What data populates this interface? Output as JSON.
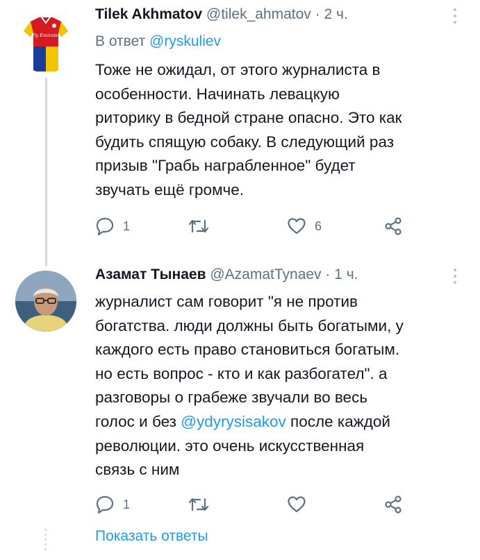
{
  "tweet1": {
    "name": "Tilek Akhmatov",
    "handle": "@tilek_ahmatov",
    "sep": "·",
    "time": "2 ч.",
    "reply_prefix": "В ответ",
    "reply_to": "@ryskuliev",
    "text": "Тоже не ожидал, от этого журналиста в\nособенности. Начинать левацкую\nриторику в  бедной стране опасно. Это как\nбудить спящую собаку. В следующий раз\nпризыв \"Грабь награбленное\" будет\nзвучать ещё громче.",
    "actions": {
      "reply_count": "1",
      "retweet_count": "",
      "like_count": "6"
    },
    "avatar_text": "Fly Emirates"
  },
  "tweet2": {
    "name": "Азамат Тынаев",
    "handle": "@AzamatTynaev",
    "sep": "·",
    "time": "1 ч.",
    "text_before": "журналист сам говорит \"я не против\nбогатства. люди должны быть богатыми, у\nкаждого есть право становиться богатым.\nно есть вопрос - кто и как разбогател\". а\nразговоры о грабеже звучали во весь\nголос и без ",
    "mention": "@ydyrysisakov",
    "text_after": " после каждой\nреволюции. это очень искусственная\nсвязь с ним",
    "actions": {
      "reply_count": "1",
      "retweet_count": "",
      "like_count": ""
    }
  },
  "show_replies": "Показать ответы",
  "colors": {
    "link": "#1d9bf0",
    "secondary": "#5b7083",
    "text": "#141823"
  }
}
